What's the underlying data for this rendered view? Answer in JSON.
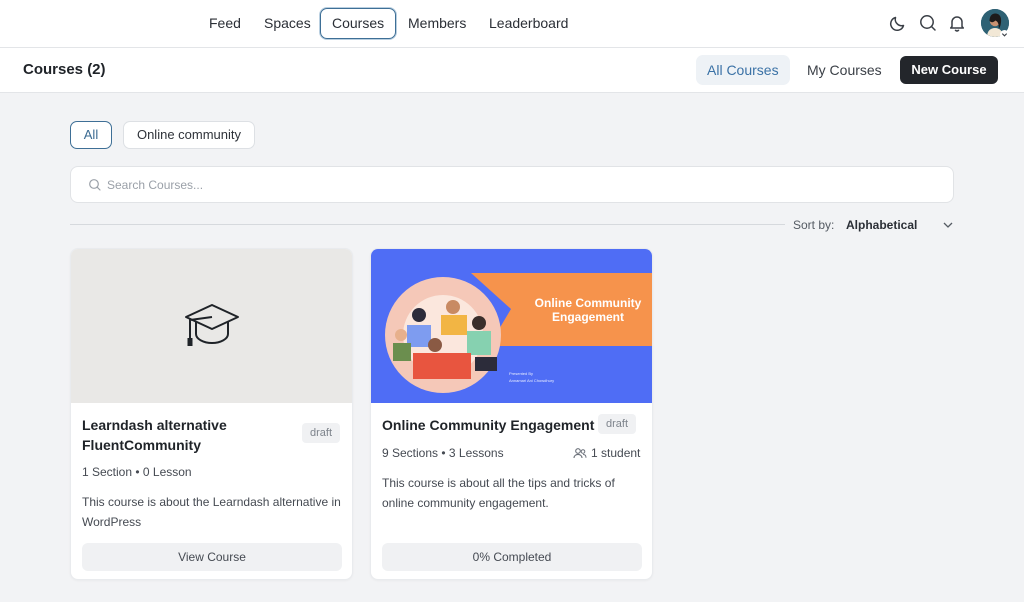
{
  "nav": {
    "items": [
      {
        "label": "Feed"
      },
      {
        "label": "Spaces"
      },
      {
        "label": "Courses"
      },
      {
        "label": "Members"
      },
      {
        "label": "Leaderboard"
      }
    ],
    "active": "Courses",
    "icons": [
      "moon-icon",
      "search-icon",
      "bell-icon"
    ]
  },
  "header": {
    "title": "Courses (2)",
    "tabs": {
      "all": "All Courses",
      "mine": "My Courses"
    },
    "new_button": "New Course"
  },
  "filters": {
    "chips": [
      "All",
      "Online community"
    ],
    "selected": "All"
  },
  "search": {
    "placeholder": "Search Courses..."
  },
  "sort": {
    "label": "Sort by:",
    "value": "Alphabetical"
  },
  "courses": [
    {
      "title": "Learndash alternative FluentCommunity",
      "status": "draft",
      "meta": "1 Section • 0 Lesson",
      "description": "This course is about the Learndash alternative in WordPress",
      "action": "View Course"
    },
    {
      "title": "Online Community Engagement",
      "status": "draft",
      "meta": "9 Sections • 3 Lessons",
      "students": "1 student",
      "description": "This course is about all the tips and tricks of online community engagement.",
      "action": "0% Completed",
      "cover_title": "Online Community Engagement",
      "cover_presenter_label": "Presented By",
      "cover_presenter": "Annamari Ani Chowdhury"
    }
  ],
  "colors": {
    "accent": "#3e6f96",
    "cover_blue": "#4f6df5",
    "cover_orange": "#f6934c",
    "button_dark": "#23262b"
  }
}
